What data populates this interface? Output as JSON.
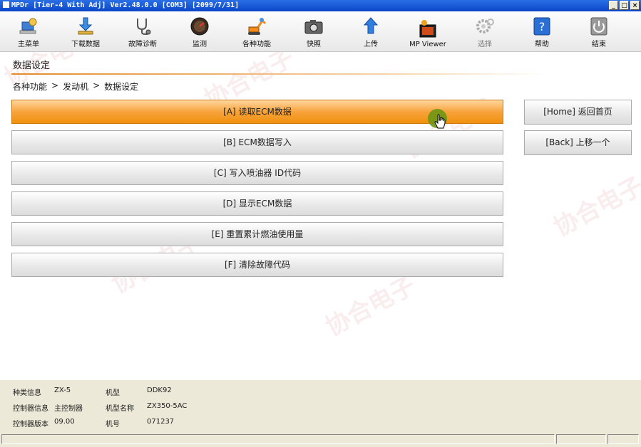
{
  "window": {
    "title": "MPDr [Tier-4 With Adj] Ver2.48.0.0 [COM3] [2099/7/31]"
  },
  "toolbar": {
    "items": [
      {
        "label": "主菜单",
        "icon": "main-menu-icon"
      },
      {
        "label": "下载数据",
        "icon": "download-icon"
      },
      {
        "label": "故障诊断",
        "icon": "stethoscope-icon"
      },
      {
        "label": "监测",
        "icon": "gauge-icon"
      },
      {
        "label": "各种功能",
        "icon": "excavator-icon"
      },
      {
        "label": "快照",
        "icon": "camera-icon"
      },
      {
        "label": "上传",
        "icon": "upload-icon"
      },
      {
        "label": "MP Viewer",
        "icon": "mp-viewer-icon"
      },
      {
        "label": "选择",
        "icon": "gear-icon"
      },
      {
        "label": "帮助",
        "icon": "help-icon"
      },
      {
        "label": "结束",
        "icon": "power-icon"
      }
    ]
  },
  "page": {
    "title": "数据设定",
    "breadcrumb": [
      "各种功能",
      ">",
      "发动机",
      ">",
      "数据设定"
    ]
  },
  "menu": [
    {
      "label": "[A] 读取ECM数据",
      "active": true
    },
    {
      "label": "[B] ECM数据写入",
      "active": false
    },
    {
      "label": "[C] 写入喷油器 ID代码",
      "active": false
    },
    {
      "label": "[D] 显示ECM数据",
      "active": false
    },
    {
      "label": "[E] 重置累计燃油使用量",
      "active": false
    },
    {
      "label": "[F] 清除故障代码",
      "active": false
    }
  ],
  "side": {
    "home": "[Home] 返回首页",
    "back": "[Back] 上移一个"
  },
  "info": {
    "kind_label": "种类信息",
    "kind_value": "ZX-5",
    "model_label": "机型",
    "model_value": "DDK92",
    "controller_label": "控制器信息",
    "controller_value": "主控制器",
    "model_name_label": "机型名称",
    "model_name_value": "ZX350-5AC",
    "version_label": "控制器版本",
    "version_value": "09.00",
    "serial_label": "机号",
    "serial_value": "071237"
  },
  "watermark": "协合电子",
  "colors": {
    "accent": "#f7a33c",
    "titlebar": "#0a46c8"
  }
}
